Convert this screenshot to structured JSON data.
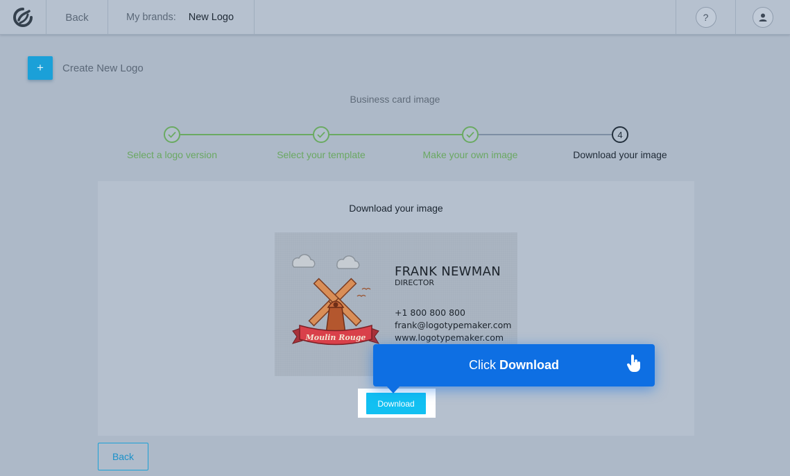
{
  "header": {
    "back_label": "Back",
    "brands_label": "My brands:",
    "brand_name": "New Logo",
    "help_label": "?"
  },
  "create": {
    "plus": "+",
    "label": "Create New Logo"
  },
  "section_title": "Business card image",
  "steps": [
    {
      "label": "Select a logo version",
      "state": "done"
    },
    {
      "label": "Select your template",
      "state": "done"
    },
    {
      "label": "Make your own image",
      "state": "done"
    },
    {
      "label": "Download your image",
      "state": "current",
      "number": "4"
    }
  ],
  "panel": {
    "title": "Download your image",
    "download_label": "Download"
  },
  "card": {
    "name": "FRANK NEWMAN",
    "role": "DIRECTOR",
    "phone": "+1 800 800 800",
    "email": "frank@logotypemaker.com",
    "website": "www.logotypemaker.com",
    "logo_text": "Moulin Rouge"
  },
  "tooltip": {
    "prefix": "Click",
    "action": "Download"
  },
  "footer": {
    "back_label": "Back"
  },
  "colors": {
    "accent": "#12c0f2",
    "tooltip": "#0e6fe3",
    "step_done": "#6aa862",
    "background": "#adb9c8"
  },
  "icons": [
    "app-logo-icon",
    "help-icon",
    "user-icon",
    "plus-icon",
    "check-icon",
    "hand-pointer-icon"
  ]
}
